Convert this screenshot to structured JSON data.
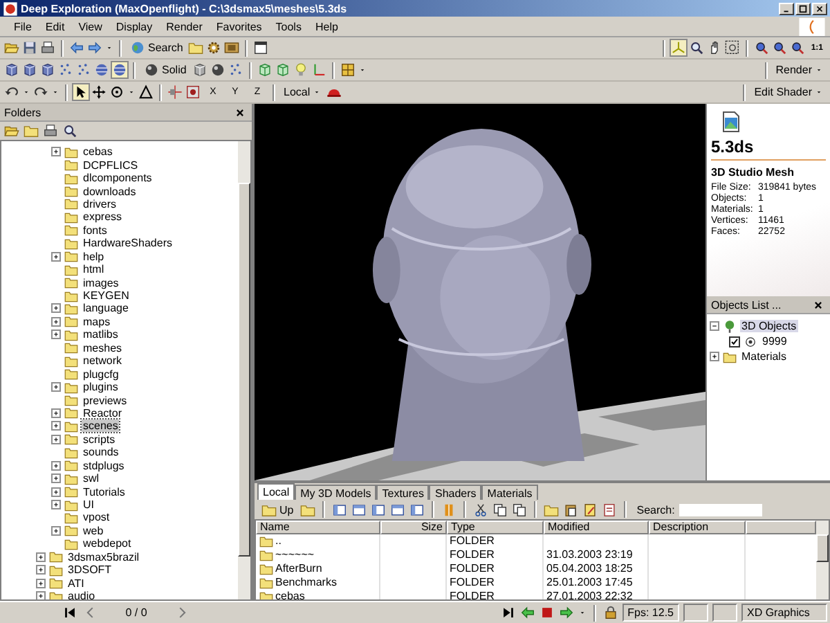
{
  "window": {
    "title": "Deep Exploration (MaxOpenflight) - C:\\3dsmax5\\meshes\\5.3ds"
  },
  "menu": [
    "File",
    "Edit",
    "View",
    "Display",
    "Render",
    "Favorites",
    "Tools",
    "Help"
  ],
  "toolbar": {
    "search": "Search",
    "solid": "Solid",
    "axes": [
      "X",
      "Y",
      "Z"
    ],
    "coordinate_space": "Local",
    "zoom_ratio": "1:1",
    "render": "Render",
    "edit_shader": "Edit Shader",
    "select_tool": {
      "pressed": true
    },
    "shaded_mode": {
      "pressed": true
    },
    "axes_view": {
      "pressed": true
    }
  },
  "folders": {
    "title": "Folders",
    "inner_items": [
      {
        "label": "cebas",
        "expandable": true,
        "selected": false
      },
      {
        "label": "DCPFLICS",
        "expandable": false,
        "selected": false
      },
      {
        "label": "dlcomponents",
        "expandable": false,
        "selected": false
      },
      {
        "label": "downloads",
        "expandable": false,
        "selected": false
      },
      {
        "label": "drivers",
        "expandable": false,
        "selected": false
      },
      {
        "label": "express",
        "expandable": false,
        "selected": false
      },
      {
        "label": "fonts",
        "expandable": false,
        "selected": false
      },
      {
        "label": "HardwareShaders",
        "expandable": false,
        "selected": false
      },
      {
        "label": "help",
        "expandable": true,
        "selected": false
      },
      {
        "label": "html",
        "expandable": false,
        "selected": false
      },
      {
        "label": "images",
        "expandable": false,
        "selected": false
      },
      {
        "label": "KEYGEN",
        "expandable": false,
        "selected": false
      },
      {
        "label": "language",
        "expandable": true,
        "selected": false
      },
      {
        "label": "maps",
        "expandable": true,
        "selected": false
      },
      {
        "label": "matlibs",
        "expandable": true,
        "selected": false
      },
      {
        "label": "meshes",
        "expandable": false,
        "selected": false
      },
      {
        "label": "network",
        "expandable": false,
        "selected": false
      },
      {
        "label": "plugcfg",
        "expandable": false,
        "selected": false
      },
      {
        "label": "plugins",
        "expandable": true,
        "selected": false
      },
      {
        "label": "previews",
        "expandable": false,
        "selected": false
      },
      {
        "label": "Reactor",
        "expandable": true,
        "selected": false
      },
      {
        "label": "scenes",
        "expandable": true,
        "selected": true
      },
      {
        "label": "scripts",
        "expandable": true,
        "selected": false
      },
      {
        "label": "sounds",
        "expandable": false,
        "selected": false
      },
      {
        "label": "stdplugs",
        "expandable": true,
        "selected": false
      },
      {
        "label": "swl",
        "expandable": true,
        "selected": false
      },
      {
        "label": "Tutorials",
        "expandable": true,
        "selected": false
      },
      {
        "label": "UI",
        "expandable": true,
        "selected": false
      },
      {
        "label": "vpost",
        "expandable": false,
        "selected": false
      },
      {
        "label": "web",
        "expandable": true,
        "selected": false
      },
      {
        "label": "webdepot",
        "expandable": false,
        "selected": false
      }
    ],
    "outer_items": [
      {
        "label": "3dsmax5brazil",
        "expandable": true,
        "selected": false
      },
      {
        "label": "3DSOFT",
        "expandable": true,
        "selected": false
      },
      {
        "label": "ATI",
        "expandable": true,
        "selected": false
      },
      {
        "label": "audio",
        "expandable": true,
        "selected": false
      }
    ]
  },
  "navigator": {
    "position": "0 / 0"
  },
  "file_info": {
    "name": "5.3ds",
    "type": "3D Studio Mesh",
    "properties": [
      {
        "label": "File Size:",
        "value": "319841 bytes"
      },
      {
        "label": "Objects:",
        "value": "1"
      },
      {
        "label": "Materials:",
        "value": "1"
      },
      {
        "label": "Vertices:",
        "value": "11461"
      },
      {
        "label": "Faces:",
        "value": "22752"
      }
    ]
  },
  "objects_list": {
    "title": "Objects List ...",
    "items": [
      {
        "label": "3D Objects",
        "expanded": true,
        "selected": true,
        "children": [
          {
            "label": "9999",
            "checked": true,
            "selected": false
          }
        ]
      },
      {
        "label": "Materials",
        "expanded": false,
        "selected": false
      }
    ]
  },
  "browser": {
    "tabs": [
      {
        "label": "Local",
        "selected": true
      },
      {
        "label": "My 3D Models",
        "selected": false
      },
      {
        "label": "Textures",
        "selected": false
      },
      {
        "label": "Shaders",
        "selected": false
      },
      {
        "label": "Materials",
        "selected": false
      }
    ],
    "up": "Up",
    "search_label": "Search:",
    "columns": [
      "Name",
      "Size",
      "Type",
      "Modified",
      "Description"
    ],
    "rows": [
      {
        "name": "..",
        "type": "FOLDER"
      },
      {
        "name": "~~~~~~",
        "type": "FOLDER",
        "modified": "31.03.2003 23:19"
      },
      {
        "name": "AfterBurn",
        "type": "FOLDER",
        "modified": "05.04.2003 18:25"
      },
      {
        "name": "Benchmarks",
        "type": "FOLDER",
        "modified": "25.01.2003 17:45"
      },
      {
        "name": "cebas",
        "type": "FOLDER",
        "modified": "27.01.2003 22:32"
      }
    ]
  },
  "status_bar": {
    "fps": "Fps: 12.5",
    "renderer": "XD Graphics"
  }
}
